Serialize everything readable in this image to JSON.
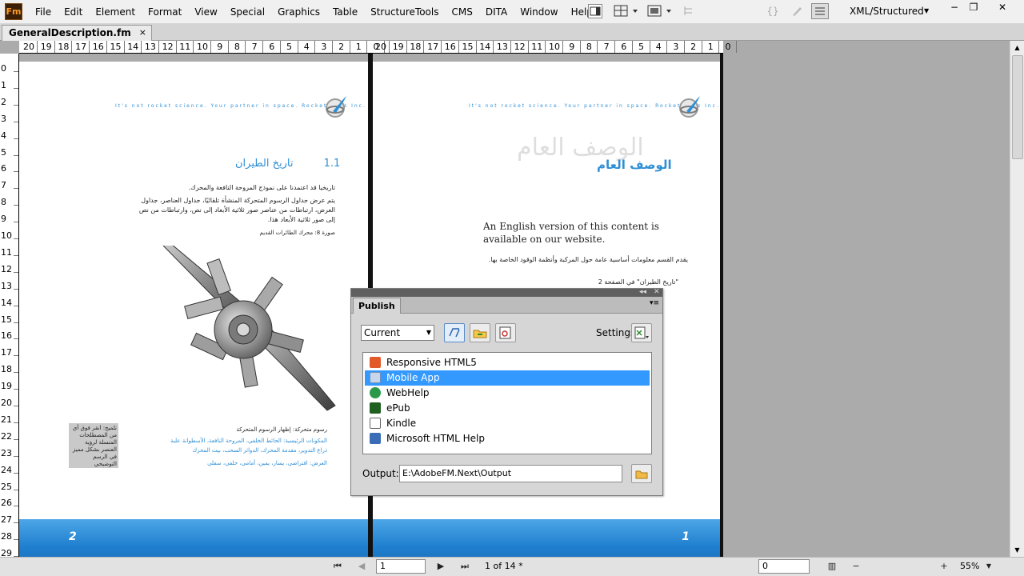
{
  "app": {
    "logo_text": "Fm",
    "workspace": "XML/Structured"
  },
  "menubar": {
    "items": [
      "File",
      "Edit",
      "Element",
      "Format",
      "View",
      "Special",
      "Graphics",
      "Table",
      "StructureTools",
      "CMS",
      "DITA",
      "Window",
      "Help"
    ]
  },
  "tabs": {
    "document_name": "GeneralDescription.fm",
    "close_glyph": "×"
  },
  "ruler": {
    "top_ticks_left": [
      "20",
      "19",
      "18",
      "17",
      "16",
      "15",
      "14",
      "13",
      "12",
      "11",
      "10",
      "9",
      "8",
      "7",
      "6",
      "5",
      "4",
      "3",
      "2",
      "1",
      "0"
    ],
    "top_ticks_right": [
      "20",
      "19",
      "18",
      "17",
      "16",
      "15",
      "14",
      "13",
      "12",
      "11",
      "10",
      "9",
      "8",
      "7",
      "6",
      "5",
      "4",
      "3",
      "2",
      "1",
      "0"
    ],
    "left_ticks": [
      "0",
      "1",
      "2",
      "3",
      "4",
      "5",
      "6",
      "7",
      "8",
      "9",
      "10",
      "11",
      "12",
      "13",
      "14",
      "15",
      "16",
      "17",
      "18",
      "19",
      "20",
      "21",
      "22",
      "23",
      "24",
      "25",
      "26",
      "27",
      "28",
      "29"
    ]
  },
  "left_page": {
    "tagline": "It's not rocket science. Your partner in space. Rocket Labs Inc.",
    "heading_number": "1.1",
    "heading_text": "تاريخ الطيران",
    "para1": "تاريخيا قد اعتمدنا على نموذج المروحة النافعة والمحرك.",
    "para2": "يتم عرض جداول الرسوم المتحركة المنشأة تلقائيًا، جداول العناصر، جداول العرض، ارتباطات من عناصر صور ثلاثية الأبعاد إلى نص، وارتباطات من نص إلى صور ثلاثية الأبعاد هذا.",
    "caption": "صورة 8: محرك الطائرات القديم",
    "sidebar_note": "تلميح: انقر فوق أي من المصطلحات المتسلة لرؤية العنصر بشكل مميز في الرسم التوضيحي",
    "legend_line1": "رسوم متحركة: إظهار الرسوم المتحركة",
    "legend_line2": "المكونات الرئيسية: الحائط الخلفي، المروحة النافعة، الأسطوانة علبة",
    "legend_line3": "ذراع التدوير، مقدمة المحرك، الدوائر السحب، بيت المحرك",
    "legend_line4": "العرض: افتراضي، يسار، يمين، أمامي، خلفي، سفلي",
    "page_number": "2"
  },
  "right_page": {
    "tagline": "It's not rocket science. Your partner in space. Rocket Labs Inc.",
    "title_ghost": "الوصف العام",
    "title": "الوصف العام",
    "english_note": "An English version of this content is available on our website.",
    "para1": "يقدم القسم معلومات أساسية عامة حول المركبة وأنظمة الوقود الخاصة بها.",
    "bullet1": "\"تاريخ الطيران\" في الصفحة 2",
    "page_number": "1"
  },
  "publish_pod": {
    "tab_label": "Publish",
    "preset": "Current",
    "settings_label": "Settings",
    "outputs": [
      "Responsive HTML5",
      "Mobile App",
      "WebHelp",
      "ePub",
      "Kindle",
      "Microsoft HTML Help"
    ],
    "selected_output": "Mobile App",
    "output_label": "Output:",
    "output_path": "E:\\AdobeFM.Next\\Output"
  },
  "statusbar": {
    "page_input": "1",
    "page_count": "1 of 14 *",
    "coord_input": "0",
    "zoom": "55%"
  },
  "icons": {
    "first_page": "⏮",
    "prev_page": "◀",
    "next_page": "▶",
    "last_page": "⏭",
    "zoom_out": "−",
    "zoom_in": "+",
    "caret": "▼",
    "minimize": "−",
    "restore": "❐",
    "close": "✕"
  },
  "colors": {
    "accent_blue": "#2f8fd5",
    "selection": "#3399ff",
    "footer_band": "#1f7fcf"
  }
}
